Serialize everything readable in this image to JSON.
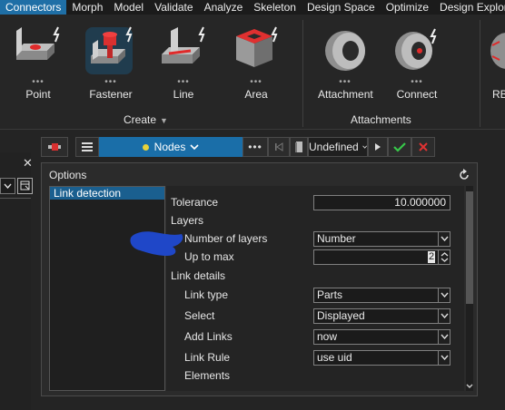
{
  "menu": {
    "items": [
      {
        "label": "Connectors",
        "active": true
      },
      {
        "label": "Morph"
      },
      {
        "label": "Model"
      },
      {
        "label": "Validate"
      },
      {
        "label": "Analyze"
      },
      {
        "label": "Skeleton"
      },
      {
        "label": "Design Space"
      },
      {
        "label": "Optimize"
      },
      {
        "label": "Design Explorer"
      }
    ]
  },
  "ribbon": {
    "create_group": {
      "label": "Create",
      "tools": [
        {
          "label": "Point",
          "icon": "point-connector-icon"
        },
        {
          "label": "Fastener",
          "icon": "fastener-icon"
        },
        {
          "label": "Line",
          "icon": "line-connector-icon"
        },
        {
          "label": "Area",
          "icon": "area-connector-icon"
        }
      ]
    },
    "attachments_group": {
      "label": "Attachments",
      "tools": [
        {
          "label": "Attachment",
          "icon": "attachment-ring-icon"
        },
        {
          "label": "Connect",
          "icon": "connect-ring-icon"
        }
      ]
    },
    "partial_tool_label": "RB"
  },
  "toolbar": {
    "entity_selector": "Nodes",
    "state_value": "Undefined"
  },
  "dialog": {
    "title": "Options",
    "side_items": [
      "Link detection"
    ],
    "rows": {
      "tolerance": {
        "label": "Tolerance",
        "value": "10.000000"
      },
      "layers": {
        "label": "Layers"
      },
      "number_of_layers": {
        "label": "Number of layers",
        "value": "Number"
      },
      "up_to_max": {
        "label": "Up to max",
        "value": "2"
      },
      "link_details": {
        "label": "Link details"
      },
      "link_type": {
        "label": "Link type",
        "value": "Parts"
      },
      "select": {
        "label": "Select",
        "value": "Displayed"
      },
      "add_links": {
        "label": "Add Links",
        "value": "now"
      },
      "link_rule": {
        "label": "Link Rule",
        "value": "use uid"
      },
      "elements": {
        "label": "Elements"
      }
    }
  },
  "colors": {
    "accent": "#1a6ea8",
    "background": "#242424",
    "annotation_blue": "#1f47c8"
  }
}
